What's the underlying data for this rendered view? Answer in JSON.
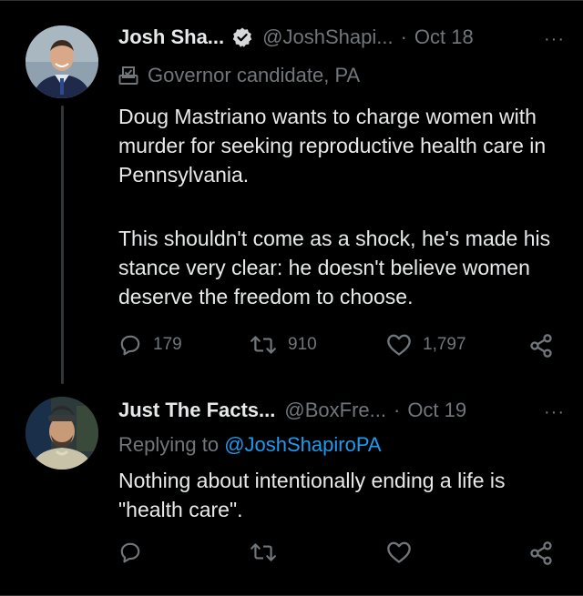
{
  "tweet1": {
    "name": "Josh Sha...",
    "handle": "@JoshShapi...",
    "separator": "·",
    "date": "Oct 18",
    "more": "···",
    "label": "Governor candidate, PA",
    "paragraph1": "Doug Mastriano wants to charge women with murder for seeking reproductive health care in Pennsylvania.",
    "paragraph2": "This shouldn't come as a shock, he's made his stance very clear: he doesn't believe women deserve the freedom to choose.",
    "replies": "179",
    "retweets": "910",
    "likes": "1,797"
  },
  "tweet2": {
    "name": "Just The Facts...",
    "handle": "@BoxFre...",
    "separator": "·",
    "date": "Oct 19",
    "more": "···",
    "replying_prefix": "Replying to ",
    "replying_handle": "@JoshShapiroPA",
    "text": "Nothing about intentionally ending a life is \"health care\"."
  },
  "colors": {
    "background": "#000000",
    "text": "#e7e9ea",
    "muted": "#71767b",
    "accent": "#1d9bf0"
  }
}
